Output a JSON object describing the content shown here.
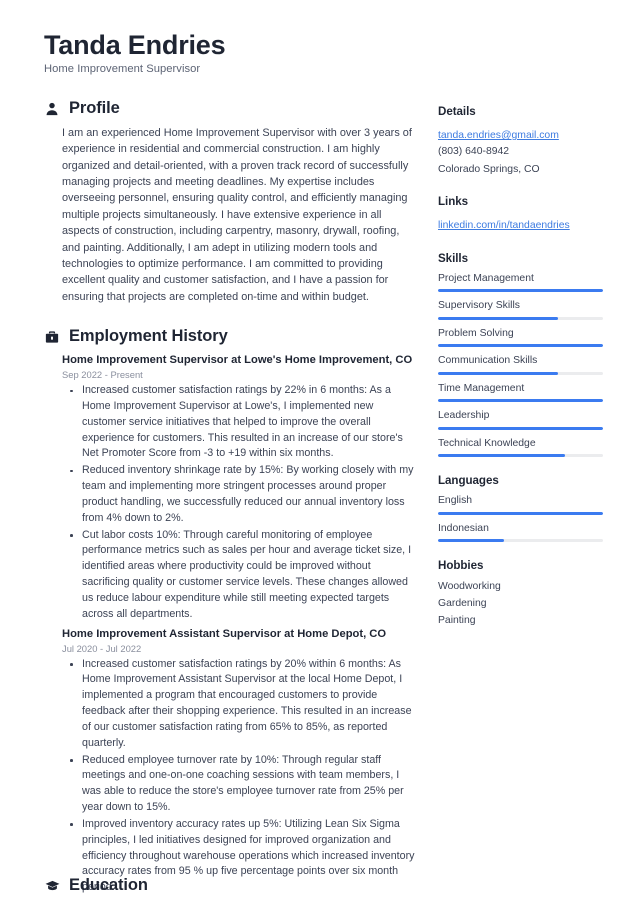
{
  "header": {
    "full_name": "Tanda Endries",
    "job_role": "Home Improvement Supervisor"
  },
  "sections": {
    "profile": {
      "icon": "person-icon",
      "title": "Profile",
      "text": "I am an experienced Home Improvement Supervisor with over 3 years of experience in residential and commercial construction. I am highly organized and detail-oriented, with a proven track record of successfully managing projects and meeting deadlines. My expertise includes overseeing personnel, ensuring quality control, and efficiently managing multiple projects simultaneously. I have extensive experience in all aspects of construction, including carpentry, masonry, drywall, roofing, and painting. Additionally, I am adept in utilizing modern tools and technologies to optimize performance. I am committed to providing excellent quality and customer satisfaction, and I have a passion for ensuring that projects are completed on-time and within budget."
    },
    "employment": {
      "icon": "briefcase-icon",
      "title": "Employment History",
      "entries": [
        {
          "title": "Home Improvement Supervisor at Lowe's Home Improvement, CO",
          "date": "Sep 2022 - Present",
          "bullets": [
            "Increased customer satisfaction ratings by 22% in 6 months: As a Home Improvement Supervisor at Lowe's, I implemented new customer service initiatives that helped to improve the overall experience for customers. This resulted in an increase of our store's Net Promoter Score from -3 to +19 within six months.",
            "Reduced inventory shrinkage rate by 15%: By working closely with my team and implementing more stringent processes around proper product handling, we successfully reduced our annual inventory loss from 4% down to 2%.",
            "Cut labor costs 10%: Through careful monitoring of employee performance metrics such as sales per hour and average ticket size, I identified areas where productivity could be improved without sacrificing quality or customer service levels. These changes allowed us reduce labour expenditure while still meeting expected targets across all departments."
          ]
        },
        {
          "title": "Home Improvement Assistant Supervisor at Home Depot, CO",
          "date": "Jul 2020 - Jul 2022",
          "bullets": [
            "Increased customer satisfaction ratings by 20% within 6 months: As Home Improvement Assistant Supervisor at the local Home Depot, I implemented a program that encouraged customers to provide feedback after their shopping experience. This resulted in an increase of our customer satisfaction rating from 65% to 85%, as reported quarterly.",
            "Reduced employee turnover rate by 10%: Through regular staff meetings and one-on-one coaching sessions with team members, I was able to reduce the store's employee turnover rate from 25% per year down to 15%.",
            "Improved inventory accuracy rates up 5%: Utilizing Lean Six Sigma principles, I led initiatives designed for improved organization and efficiency throughout warehouse operations which increased inventory accuracy rates from 95 % up five percentage points over six month period."
          ]
        }
      ]
    },
    "education": {
      "icon": "graduation-cap-icon",
      "title": "Education"
    }
  },
  "sidebar": {
    "details": {
      "title": "Details",
      "email": "tanda.endries@gmail.com",
      "phone": "(803) 640-8942",
      "location": "Colorado Springs, CO"
    },
    "links": {
      "title": "Links",
      "items": [
        {
          "label": "linkedin.com/in/tandaendries"
        }
      ]
    },
    "skills": {
      "title": "Skills",
      "items": [
        {
          "label": "Project Management",
          "level": 100
        },
        {
          "label": "Supervisory Skills",
          "level": 73
        },
        {
          "label": "Problem Solving",
          "level": 100
        },
        {
          "label": "Communication Skills",
          "level": 73
        },
        {
          "label": "Time Management",
          "level": 100
        },
        {
          "label": "Leadership",
          "level": 100
        },
        {
          "label": "Technical Knowledge",
          "level": 77
        }
      ]
    },
    "languages": {
      "title": "Languages",
      "items": [
        {
          "label": "English",
          "level": 100
        },
        {
          "label": "Indonesian",
          "level": 40
        }
      ]
    },
    "hobbies": {
      "title": "Hobbies",
      "items": [
        {
          "label": "Woodworking"
        },
        {
          "label": "Gardening"
        },
        {
          "label": "Painting"
        }
      ]
    }
  },
  "theme": {
    "accent": "#3b7bf0",
    "link": "#3d7be0",
    "heading": "#1f2533",
    "body_text": "#3c4355",
    "muted": "#8a8f9e",
    "track": "#ebecee"
  }
}
